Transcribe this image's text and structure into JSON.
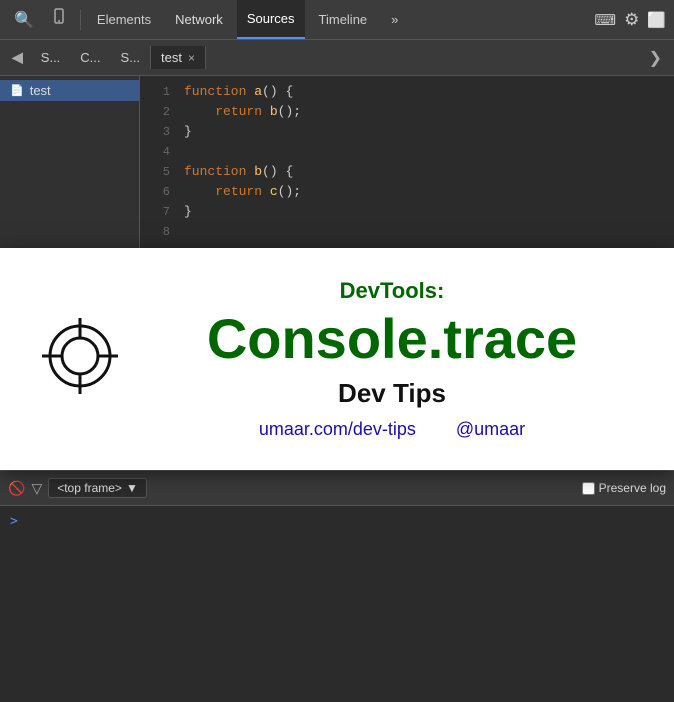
{
  "toolbar": {
    "tabs": [
      {
        "id": "elements",
        "label": "Elements",
        "active": false
      },
      {
        "id": "network",
        "label": "Network",
        "active": false
      },
      {
        "id": "sources",
        "label": "Sources",
        "active": true
      },
      {
        "id": "timeline",
        "label": "Timeline",
        "active": false
      },
      {
        "id": "more",
        "label": "»",
        "active": false
      }
    ],
    "icons": {
      "search": "🔍",
      "device": "📱",
      "terminal": "⎘",
      "settings": "⚙",
      "dock": "🗖",
      "more_right": "⋮"
    }
  },
  "sources_subtoolbar": {
    "panel_btn": "◀",
    "tabs": [
      {
        "label": "S..."
      },
      {
        "label": "C..."
      },
      {
        "label": "S..."
      }
    ],
    "active_file": "test",
    "close_btn": "×",
    "right_btn": "❯"
  },
  "sidebar": {
    "items": [
      {
        "label": "test",
        "selected": true
      }
    ]
  },
  "code": {
    "lines": [
      {
        "num": 1,
        "content": "function a() {"
      },
      {
        "num": 2,
        "content": "    return b();"
      },
      {
        "num": 3,
        "content": "}"
      },
      {
        "num": 4,
        "content": ""
      },
      {
        "num": 5,
        "content": "function b() {"
      },
      {
        "num": 6,
        "content": "    return c();"
      },
      {
        "num": 7,
        "content": "}"
      },
      {
        "num": 8,
        "content": ""
      }
    ]
  },
  "overlay": {
    "subtitle": "DevTools:",
    "title": "Console.trace",
    "label": "Dev Tips",
    "link1": {
      "text": "umaar.com/dev-tips",
      "url": "#"
    },
    "link2": {
      "text": "@umaar",
      "url": "#"
    }
  },
  "console": {
    "filter_placeholder": "",
    "frame_label": "<top frame>",
    "preserve_log_label": "Preserve log",
    "prompt_symbol": ">"
  }
}
